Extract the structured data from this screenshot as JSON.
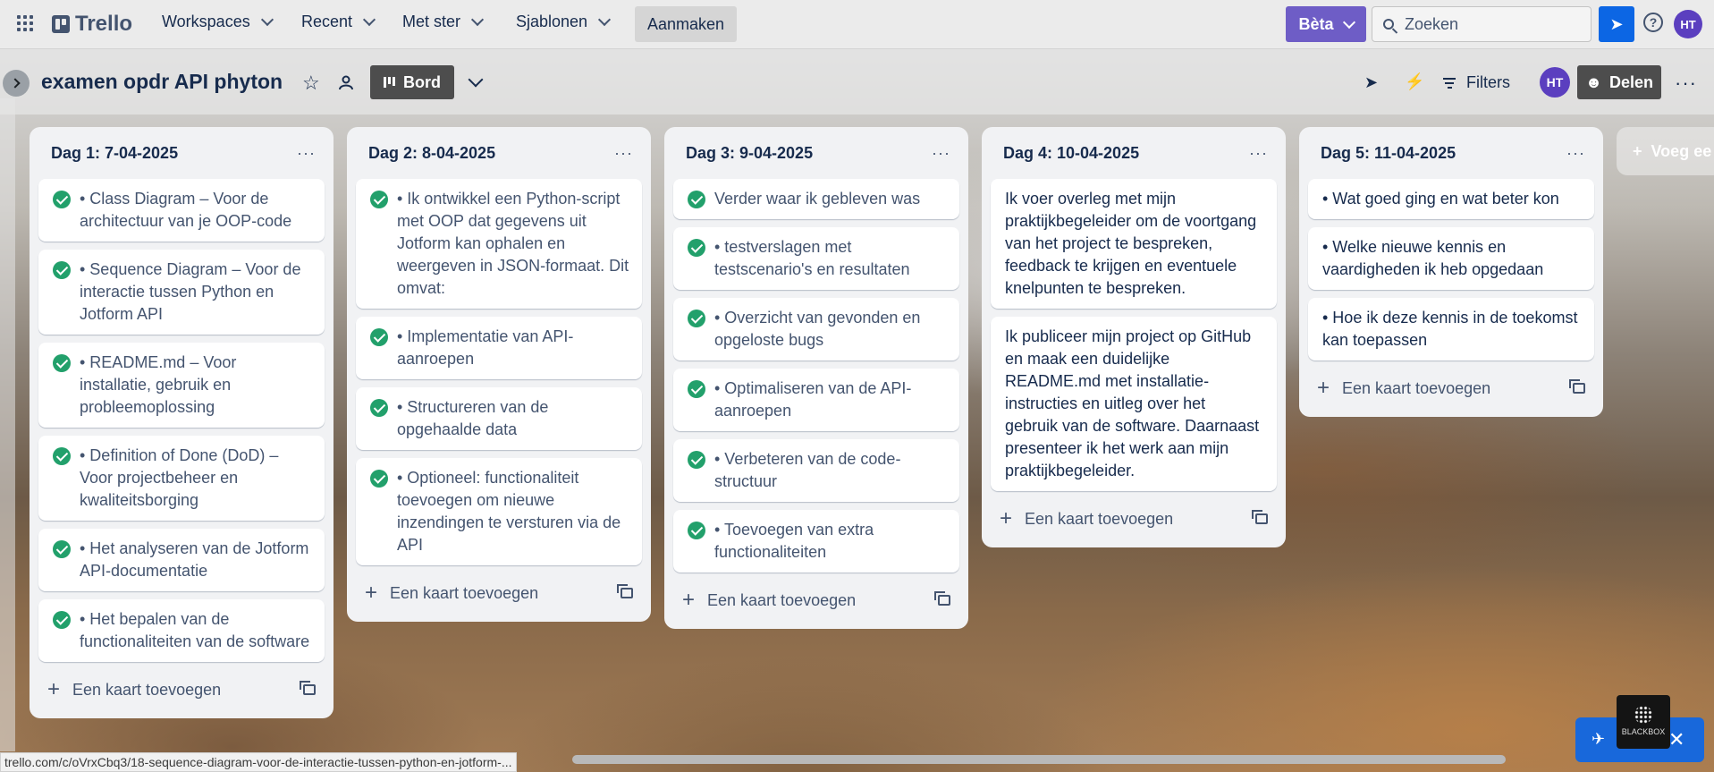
{
  "topnav": {
    "logo": "Trello",
    "menus": [
      {
        "label": "Workspaces"
      },
      {
        "label": "Recent"
      },
      {
        "label": "Met ster"
      },
      {
        "label": "Sjablonen"
      }
    ],
    "create_label": "Aanmaken",
    "beta_label": "Bèta",
    "search_placeholder": "Zoeken",
    "avatar_initials": "HT",
    "accent_color": "#0c66e4",
    "beta_color": "#6e5dc6"
  },
  "board": {
    "title": "examen opdr API phyton",
    "view_label": "Bord",
    "filters_label": "Filters",
    "member_initials": "HT",
    "share_label": "Delen",
    "add_list_label": "Voeg ee"
  },
  "lists": [
    {
      "title": "Dag 1: 7-04-2025",
      "add_card": "Een kaart toevoegen",
      "cards": [
        {
          "text": "• Class Diagram – Voor de architectuur van je OOP-code",
          "done": true
        },
        {
          "text": "• Sequence Diagram – Voor de interactie tussen Python en Jotform API",
          "done": true
        },
        {
          "text": "• README.md – Voor installatie, gebruik en probleemoplossing",
          "done": true
        },
        {
          "text": "• Definition of Done (DoD) – Voor projectbeheer en kwaliteitsborging",
          "done": true
        },
        {
          "text": "• Het analyseren van de Jotform API-documentatie",
          "done": true
        },
        {
          "text": "• Het bepalen van de functionaliteiten van de software",
          "done": true
        }
      ]
    },
    {
      "title": "Dag 2: 8-04-2025",
      "add_card": "Een kaart toevoegen",
      "cards": [
        {
          "text": "• Ik ontwikkel een Python-script met OOP dat gegevens uit Jotform kan ophalen en weergeven in JSON-formaat. Dit omvat:",
          "done": true
        },
        {
          "text": "• Implementatie van API-aanroepen",
          "done": true
        },
        {
          "text": "• Structureren van de opgehaalde data",
          "done": true
        },
        {
          "text": "• Optioneel: functionaliteit toevoegen om nieuwe inzendingen te versturen via de API",
          "done": true
        }
      ]
    },
    {
      "title": "Dag 3: 9-04-2025",
      "add_card": "Een kaart toevoegen",
      "cards": [
        {
          "text": "Verder waar ik gebleven was",
          "done": true
        },
        {
          "text": "• testverslagen met testscenario's en resultaten",
          "done": true
        },
        {
          "text": "• Overzicht van gevonden en opgeloste bugs",
          "done": true
        },
        {
          "text": "• Optimaliseren van de API-aanroepen",
          "done": true
        },
        {
          "text": "• Verbeteren van de code-structuur",
          "done": true
        },
        {
          "text": "• Toevoegen van extra functionaliteiten",
          "done": true
        }
      ]
    },
    {
      "title": "Dag 4: 10-04-2025",
      "add_card": "Een kaart toevoegen",
      "cards": [
        {
          "text": "Ik voer overleg met mijn praktijkbegeleider om de voortgang van het project te bespreken, feedback te krijgen en eventuele knelpunten te bespreken.",
          "done": false
        },
        {
          "text": "Ik publiceer mijn project op GitHub en maak een duidelijke README.md met installatie-instructies en uitleg over het gebruik van de software. Daarnaast presenteer ik het werk aan mijn praktijkbegeleider.",
          "done": false
        }
      ]
    },
    {
      "title": "Dag 5: 11-04-2025",
      "add_card": "Een kaart toevoegen",
      "cards": [
        {
          "text": "• Wat goed ging en wat beter kon",
          "done": false
        },
        {
          "text": "• Welke nieuwe kennis en vaardigheden ik heb opgedaan",
          "done": false
        },
        {
          "text": "• Hoe ik deze kennis in de toekomst kan toepassen",
          "done": false
        }
      ]
    }
  ],
  "statusbar": {
    "url": "trello.com/c/oVrxCbq3/18-sequence-diagram-voor-de-interactie-tussen-python-en-jotform-..."
  },
  "widget": {
    "badge": "BLACKBOX"
  }
}
